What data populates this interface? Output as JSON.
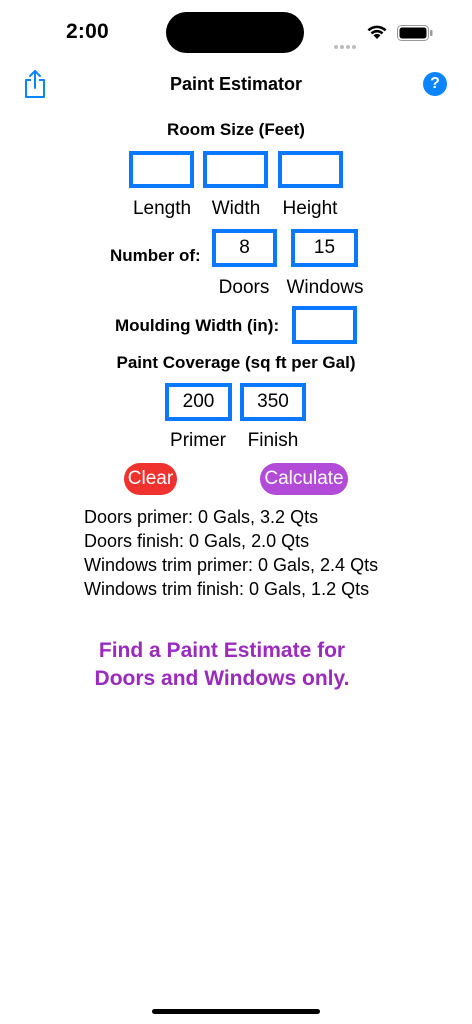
{
  "status_bar": {
    "time": "2:00"
  },
  "nav": {
    "title": "Paint Estimator",
    "help_glyph": "?",
    "share_icon": "share-icon",
    "help_icon": "question-mark-icon"
  },
  "room_size": {
    "title": "Room Size (Feet)",
    "length": {
      "label": "Length",
      "value": ""
    },
    "width": {
      "label": "Width",
      "value": ""
    },
    "height": {
      "label": "Height",
      "value": ""
    }
  },
  "number_of": {
    "label": "Number of:",
    "doors": {
      "label": "Doors",
      "value": "8"
    },
    "windows": {
      "label": "Windows",
      "value": "15"
    }
  },
  "moulding": {
    "label": "Moulding Width (in):",
    "value": ""
  },
  "coverage": {
    "title": "Paint Coverage (sq ft per Gal)",
    "primer": {
      "label": "Primer",
      "value": "200"
    },
    "finish": {
      "label": "Finish",
      "value": "350"
    }
  },
  "buttons": {
    "clear": "Clear",
    "calculate": "Calculate"
  },
  "results": [
    "Doors primer: 0 Gals, 3.2 Qts",
    "Doors finish: 0 Gals, 2.0 Qts",
    "Windows trim primer: 0 Gals, 2.4 Qts",
    "Windows trim finish: 0 Gals, 1.2 Qts"
  ],
  "promo": {
    "line1": "Find a Paint Estimate for",
    "line2": "Doors and Windows only."
  },
  "colors": {
    "accent_blue": "#0a78ff",
    "clear_red": "#f0322e",
    "calculate_purple": "#b14bd8",
    "promo_purple": "#9a2bbd"
  }
}
